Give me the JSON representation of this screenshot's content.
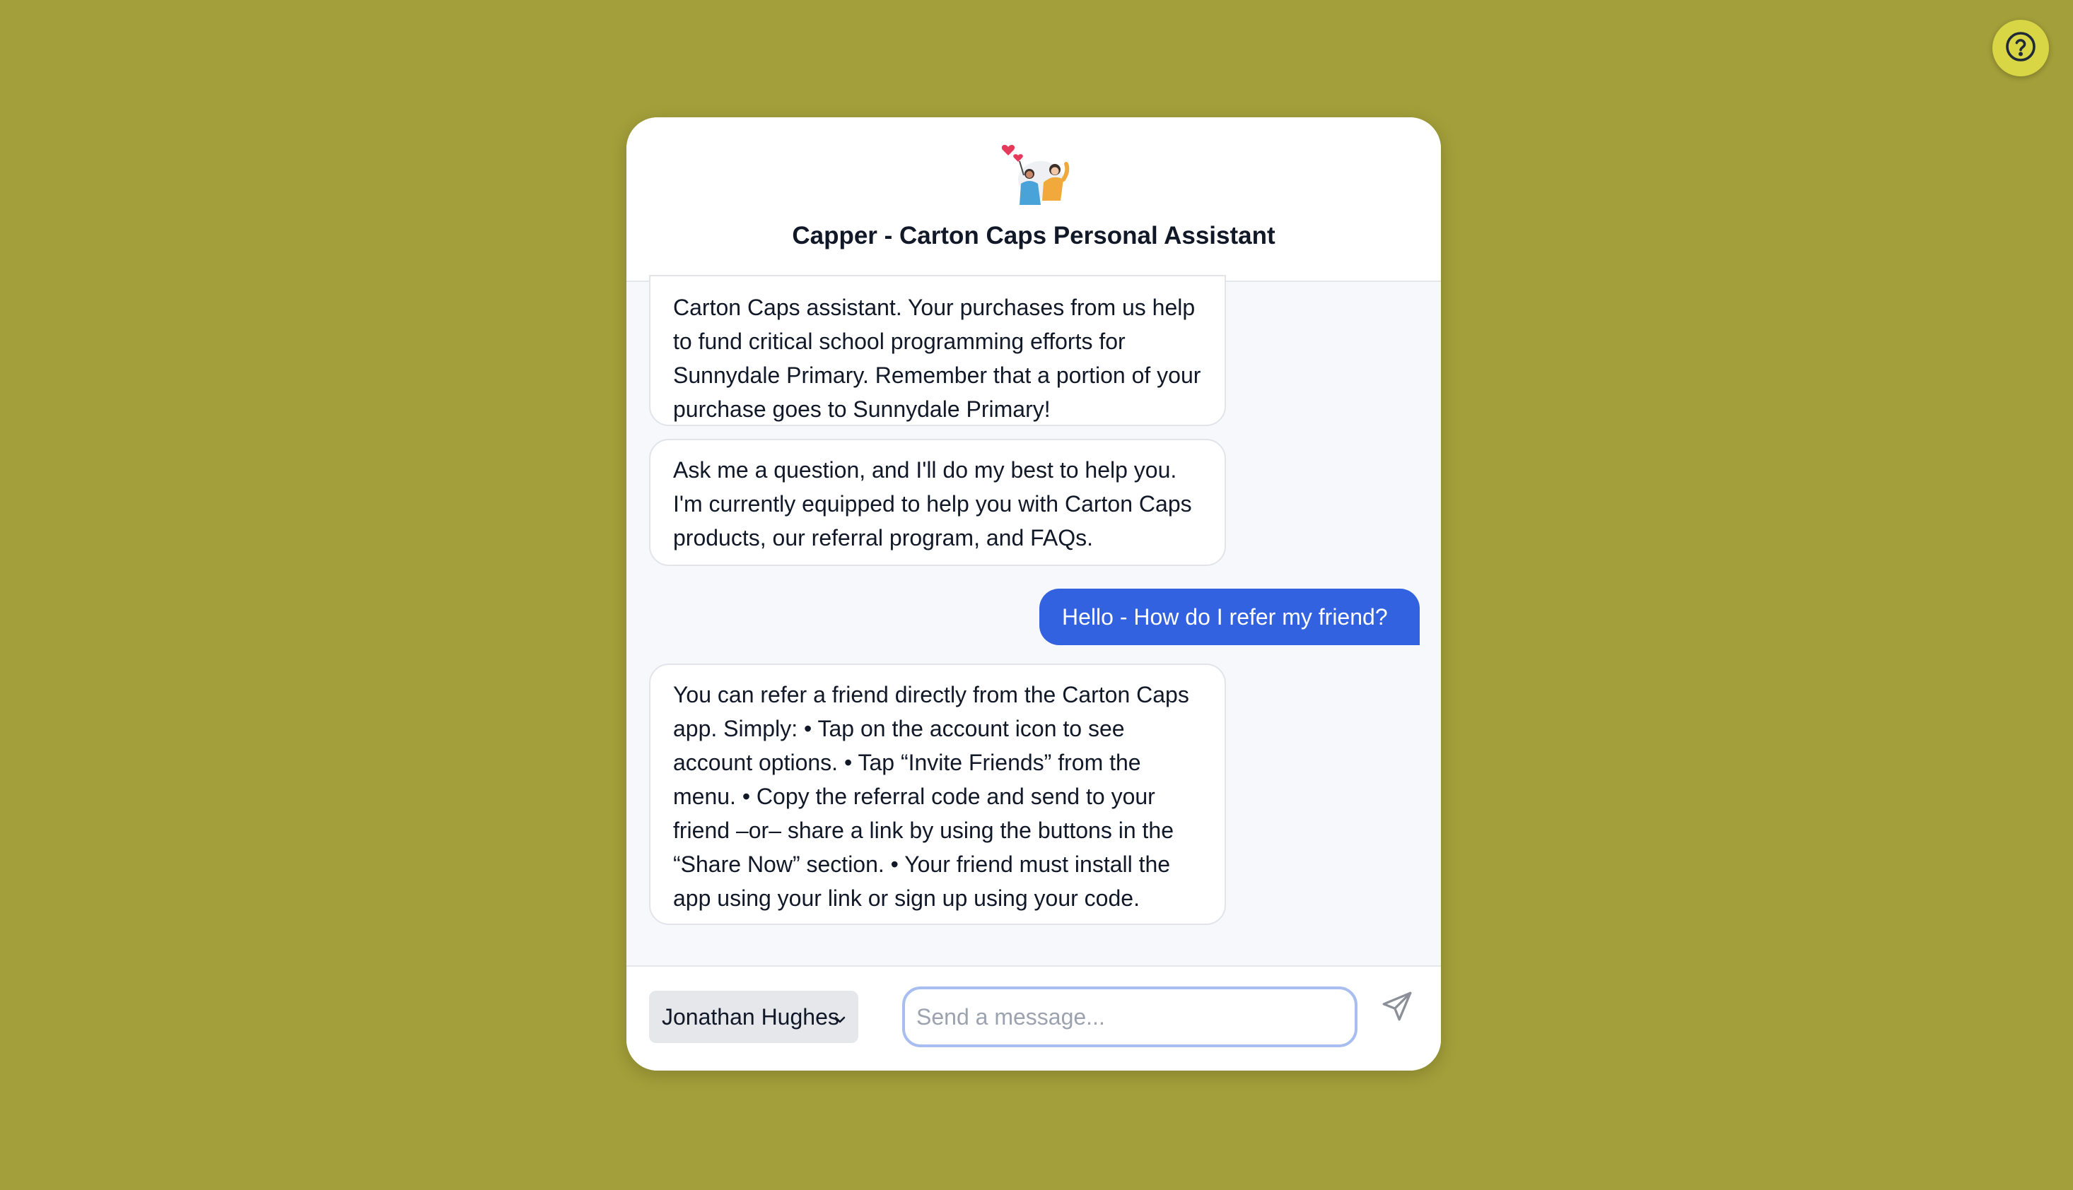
{
  "help": {
    "icon": "question-circle-icon"
  },
  "header": {
    "logo_icon": "capper-illustration-icon",
    "title": "Capper - Carton Caps Personal Assistant"
  },
  "messages": [
    {
      "role": "assistant",
      "text": "Carton Caps assistant. Your purchases from us help to fund critical school programming efforts for Sunnydale Primary. Remember that a portion of your purchase goes to Sunnydale Primary!"
    },
    {
      "role": "assistant",
      "text": "Ask me a question, and I'll do my best to help you. I'm currently equipped to help you with Carton Caps products, our referral program, and FAQs."
    },
    {
      "role": "user",
      "text": "Hello - How do I refer my friend?"
    },
    {
      "role": "assistant",
      "text": "You can refer a friend directly from the Carton Caps app. Simply: • Tap on the account icon to see account options. • Tap “Invite Friends” from the menu. • Copy the referral code and send to your friend –or– share a link by using the buttons in the “Share Now” section. • Your friend must install the app using your link or sign up using your code."
    }
  ],
  "composer": {
    "selected_user": "Jonathan Hughes",
    "input_value": "",
    "input_placeholder": "Send a message...",
    "send_icon": "paper-plane-icon"
  },
  "colors": {
    "background": "#a39f3a",
    "help_button": "#d9d645",
    "user_bubble": "#3362e0",
    "input_focus_ring": "#a8bdf0"
  }
}
